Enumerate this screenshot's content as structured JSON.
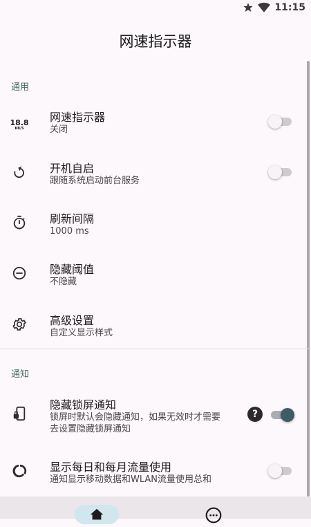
{
  "status_bar": {
    "time": "11:15"
  },
  "app_bar": {
    "title": "网速指示器"
  },
  "sections": {
    "general": "通用",
    "notification": "通知"
  },
  "settings": {
    "speed_indicator": {
      "title": "网速指示器",
      "subtitle": "关闭",
      "icon_text": "18.8",
      "icon_unit": "KB/S",
      "enabled": false
    },
    "autostart": {
      "title": "开机自启",
      "subtitle": "跟随系统启动前台服务",
      "enabled": false
    },
    "refresh_interval": {
      "title": "刷新间隔",
      "subtitle": "1000 ms"
    },
    "hide_threshold": {
      "title": "隐藏阈值",
      "subtitle": "不隐藏"
    },
    "advanced": {
      "title": "高级设置",
      "subtitle": "自定义显示样式"
    },
    "hide_lockscreen": {
      "title": "隐藏锁屏通知",
      "subtitle_line1": "锁屏时默认会隐藏通知，如果无效时才需要",
      "subtitle_line2": "去设置隐藏锁屏通知",
      "help": "?",
      "enabled": true
    },
    "daily_monthly": {
      "title": "显示每日和每月流量使用",
      "subtitle": "通知显示移动数据和WLAN流量使用总和",
      "enabled": false
    }
  },
  "colors": {
    "accent": "#3f5b66",
    "section_header": "#4a6b63",
    "background": "#fcf8fb"
  }
}
